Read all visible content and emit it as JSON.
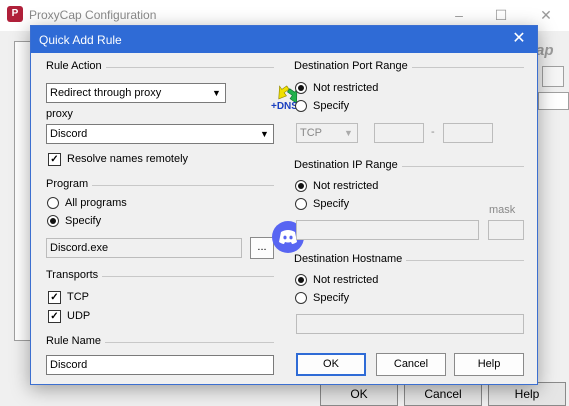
{
  "parent": {
    "title": "ProxyCap Configuration",
    "caption_partial": "ap",
    "buttons": [
      "OK",
      "Cancel",
      "Help"
    ]
  },
  "dialog": {
    "title": "Quick Add Rule",
    "rule_action": {
      "label": "Rule Action",
      "value": "Redirect through proxy",
      "dns_badge": "+DNS"
    },
    "proxy": {
      "label": "proxy",
      "value": "Discord",
      "resolve_label": "Resolve names remotely",
      "resolve_checked": true
    },
    "program": {
      "label": "Program",
      "options": [
        "All programs",
        "Specify"
      ],
      "selected": "Specify",
      "path": "Discord.exe",
      "browse_label": "..."
    },
    "transports": {
      "label": "Transports",
      "tcp_label": "TCP",
      "udp_label": "UDP",
      "tcp_checked": true,
      "udp_checked": true
    },
    "rule_name": {
      "label": "Rule Name",
      "value": "Discord"
    },
    "dest_port": {
      "label": "Destination Port Range",
      "options": [
        "Not restricted",
        "Specify"
      ],
      "selected": "Not restricted",
      "protocol": "TCP",
      "separator": "-"
    },
    "dest_ip": {
      "label": "Destination IP Range",
      "options": [
        "Not restricted",
        "Specify"
      ],
      "selected": "Not restricted",
      "mask_label": "mask"
    },
    "dest_host": {
      "label": "Destination Hostname",
      "options": [
        "Not restricted",
        "Specify"
      ],
      "selected": "Not restricted"
    },
    "buttons": {
      "ok": "OK",
      "cancel": "Cancel",
      "help": "Help"
    }
  },
  "colors": {
    "titlebar": "#2f6bd6",
    "discord": "#5865f2"
  },
  "icons": [
    "proxycap-app-icon",
    "dns-arrows-icon",
    "discord-icon",
    "close-icon",
    "minimize-icon",
    "maximize-icon"
  ]
}
